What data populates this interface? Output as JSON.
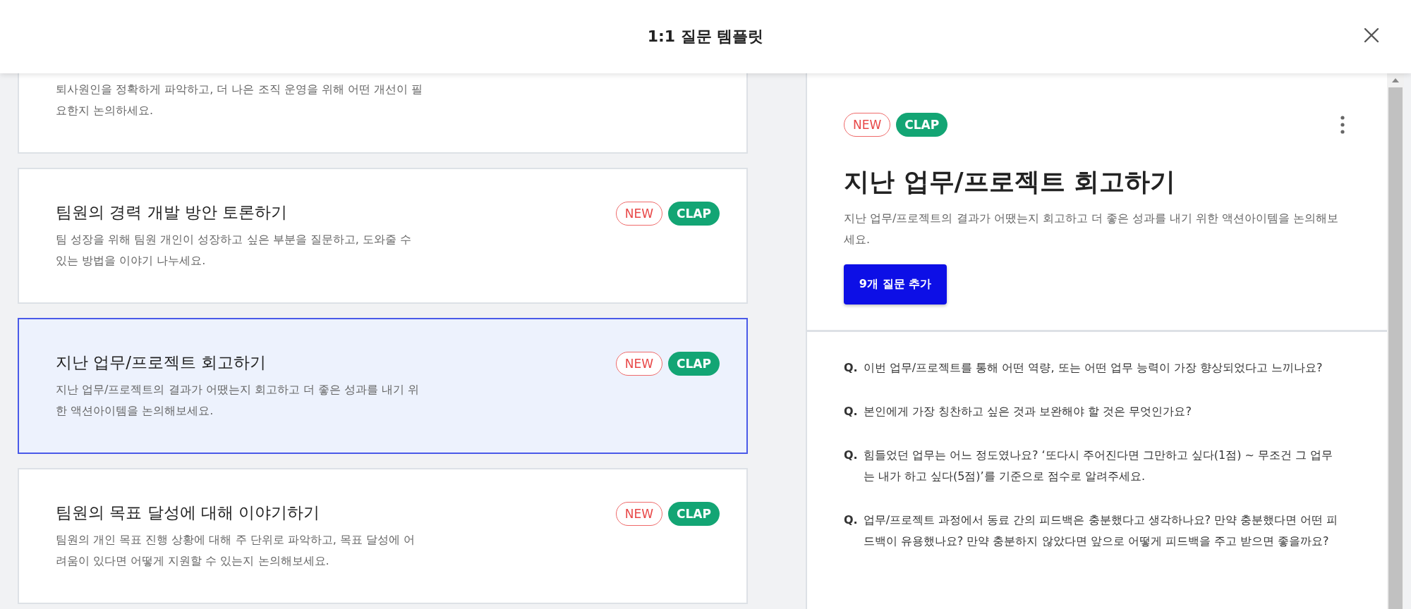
{
  "header": {
    "title": "1:1 질문 템플릿"
  },
  "templates": [
    {
      "description": "퇴사원인을 정확하게 파악하고, 더 나은 조직 운영을 위해 어떤 개선이 필요한지 논의하세요.",
      "selected": false
    },
    {
      "title": "팀원의 경력 개발 방안 토론하기",
      "description": "팀 성장을 위해 팀원 개인이 성장하고 싶은 부분을 질문하고, 도와줄 수 있는 방법을 이야기 나누세요.",
      "badges": [
        {
          "label": "NEW",
          "kind": "new"
        },
        {
          "label": "CLAP",
          "kind": "clap"
        }
      ],
      "selected": false
    },
    {
      "title": "지난 업무/프로젝트 회고하기",
      "description": "지난 업무/프로젝트의 결과가 어땠는지 회고하고 더 좋은 성과를 내기 위한 액션아이템을 논의해보세요.",
      "badges": [
        {
          "label": "NEW",
          "kind": "new"
        },
        {
          "label": "CLAP",
          "kind": "clap"
        }
      ],
      "selected": true
    },
    {
      "title": "팀원의 목표 달성에 대해 이야기하기",
      "description": "팀원의 개인 목표 진행 상황에 대해 주 단위로 파악하고, 목표 달성에 어려움이 있다면 어떻게 지원할 수 있는지 논의해보세요.",
      "badges": [
        {
          "label": "NEW",
          "kind": "new"
        },
        {
          "label": "CLAP",
          "kind": "clap"
        }
      ],
      "selected": false
    }
  ],
  "detail": {
    "badges": [
      {
        "label": "NEW",
        "kind": "new"
      },
      {
        "label": "CLAP",
        "kind": "clap"
      }
    ],
    "title": "지난 업무/프로젝트 회고하기",
    "description": "지난 업무/프로젝트의 결과가 어땠는지 회고하고 더 좋은 성과를 내기 위한 액션아이템을 논의해보세요.",
    "add_button": "9개 질문 추가",
    "questions": [
      {
        "prefix": "Q.",
        "text": "이번 업무/프로젝트를 통해 어떤 역량, 또는 어떤 업무 능력이 가장 향상되었다고 느끼나요?"
      },
      {
        "prefix": "Q.",
        "text": "본인에게 가장 칭찬하고 싶은 것과 보완해야 할 것은 무엇인가요?"
      },
      {
        "prefix": "Q.",
        "text": "힘들었던 업무는 어느 정도였나요? ‘또다시 주어진다면 그만하고 싶다(1점) ~ 무조건 그 업무는 내가 하고 싶다(5점)’를 기준으로 점수로 알려주세요."
      },
      {
        "prefix": "Q.",
        "text": "업무/프로젝트 과정에서 동료 간의 피드백은 충분했다고 생각하나요? 만약 충분했다면 어떤 피드백이 유용했나요? 만약 충분하지 않았다면 앞으로 어떻게 피드백을 주고 받으면 좋을까요?"
      }
    ]
  }
}
